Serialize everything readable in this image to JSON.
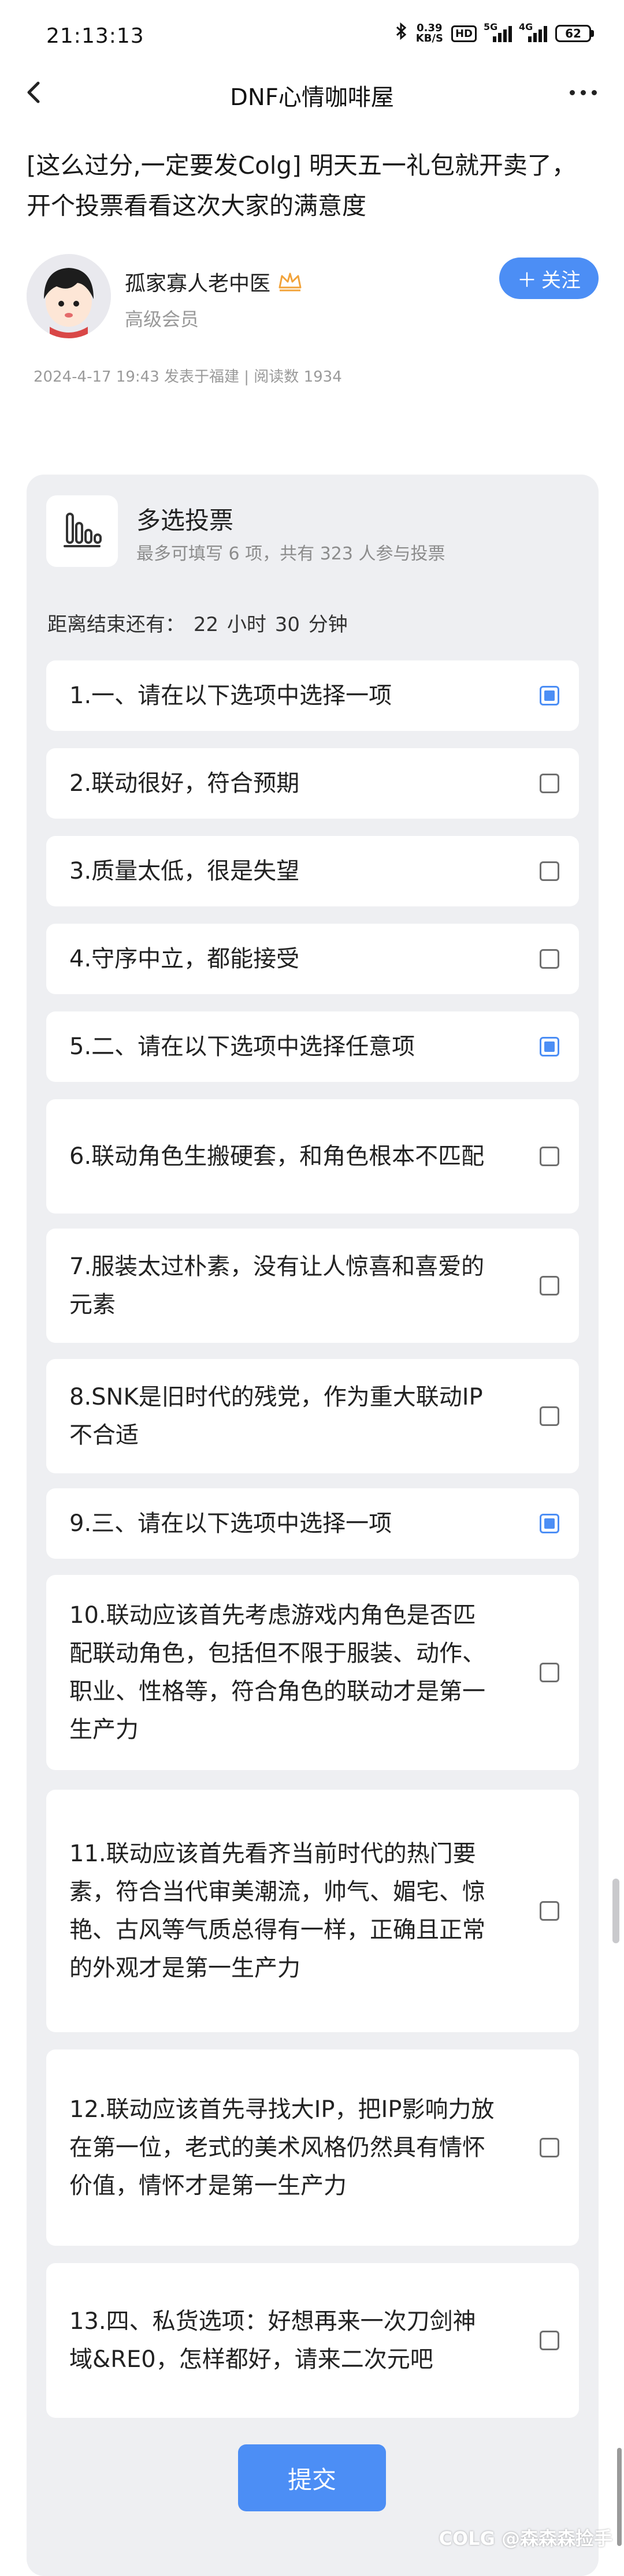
{
  "status_bar": {
    "time": "21:13:13",
    "net_speed_value": "0.39",
    "net_speed_unit": "KB/S",
    "hd_label": "HD",
    "signal1_label": "5G",
    "signal2_label": "4G",
    "battery": "62"
  },
  "nav": {
    "title": "DNF心情咖啡屋"
  },
  "post": {
    "title": "[这么过分,一定要发Colg] 明天五一礼包就开卖了，开个投票看看这次大家的满意度",
    "author_name": "孤家寡人老中医",
    "author_level": "高级会员",
    "follow_label": "关注",
    "meta": "2024-4-17 19:43 发表于福建 | 阅读数 1934"
  },
  "vote": {
    "type": "多选投票",
    "subtitle": "最多可填写 6 项，共有 323 人参与投票",
    "deadline_label": "距离结束还有：",
    "deadline_hours": "22",
    "deadline_hours_unit": "小时",
    "deadline_minutes": "30",
    "deadline_minutes_unit": "分钟",
    "options": [
      {
        "text": "1.一、请在以下选项中选择一项",
        "checked": true
      },
      {
        "text": "2.联动很好，符合预期",
        "checked": false
      },
      {
        "text": "3.质量太低，很是失望",
        "checked": false
      },
      {
        "text": "4.守序中立，都能接受",
        "checked": false
      },
      {
        "text": "5.二、请在以下选项中选择任意项",
        "checked": true
      },
      {
        "text": "6.联动角色生搬硬套，和角色根本不匹配",
        "checked": false
      },
      {
        "text": "7.服装太过朴素，没有让人惊喜和喜爱的元素",
        "checked": false
      },
      {
        "text": "8.SNK是旧时代的残党，作为重大联动IP不合适",
        "checked": false
      },
      {
        "text": "9.三、请在以下选项中选择一项",
        "checked": true
      },
      {
        "text": "10.联动应该首先考虑游戏内角色是否匹配联动角色，包括但不限于服装、动作、职业、性格等，符合角色的联动才是第一生产力",
        "checked": false
      },
      {
        "text": "11.联动应该首先看齐当前时代的热门要素，符合当代审美潮流，帅气、媚宅、惊艳、古风等气质总得有一样，正确且正常的外观才是第一生产力",
        "checked": false
      },
      {
        "text": "12.联动应该首先寻找大IP，把IP影响力放在第一位，老式的美术风格仍然具有情怀价值，情怀才是第一生产力",
        "checked": false
      },
      {
        "text": "13.四、私货选项：好想再来一次刀剑神域&RE0，怎样都好，请来二次元吧",
        "checked": false
      }
    ],
    "submit_label": "提交"
  },
  "watermark": "COLG @森森森捡手",
  "colors": {
    "accent": "#4c8ef5",
    "card_bg": "#eeeff2",
    "muted_text": "#8c8c8c"
  },
  "icons": {
    "back": "chevron-left-icon",
    "more": "more-dots-icon",
    "vote": "bar-chart-icon",
    "crown": "crown-icon",
    "bluetooth": "bluetooth-icon"
  }
}
